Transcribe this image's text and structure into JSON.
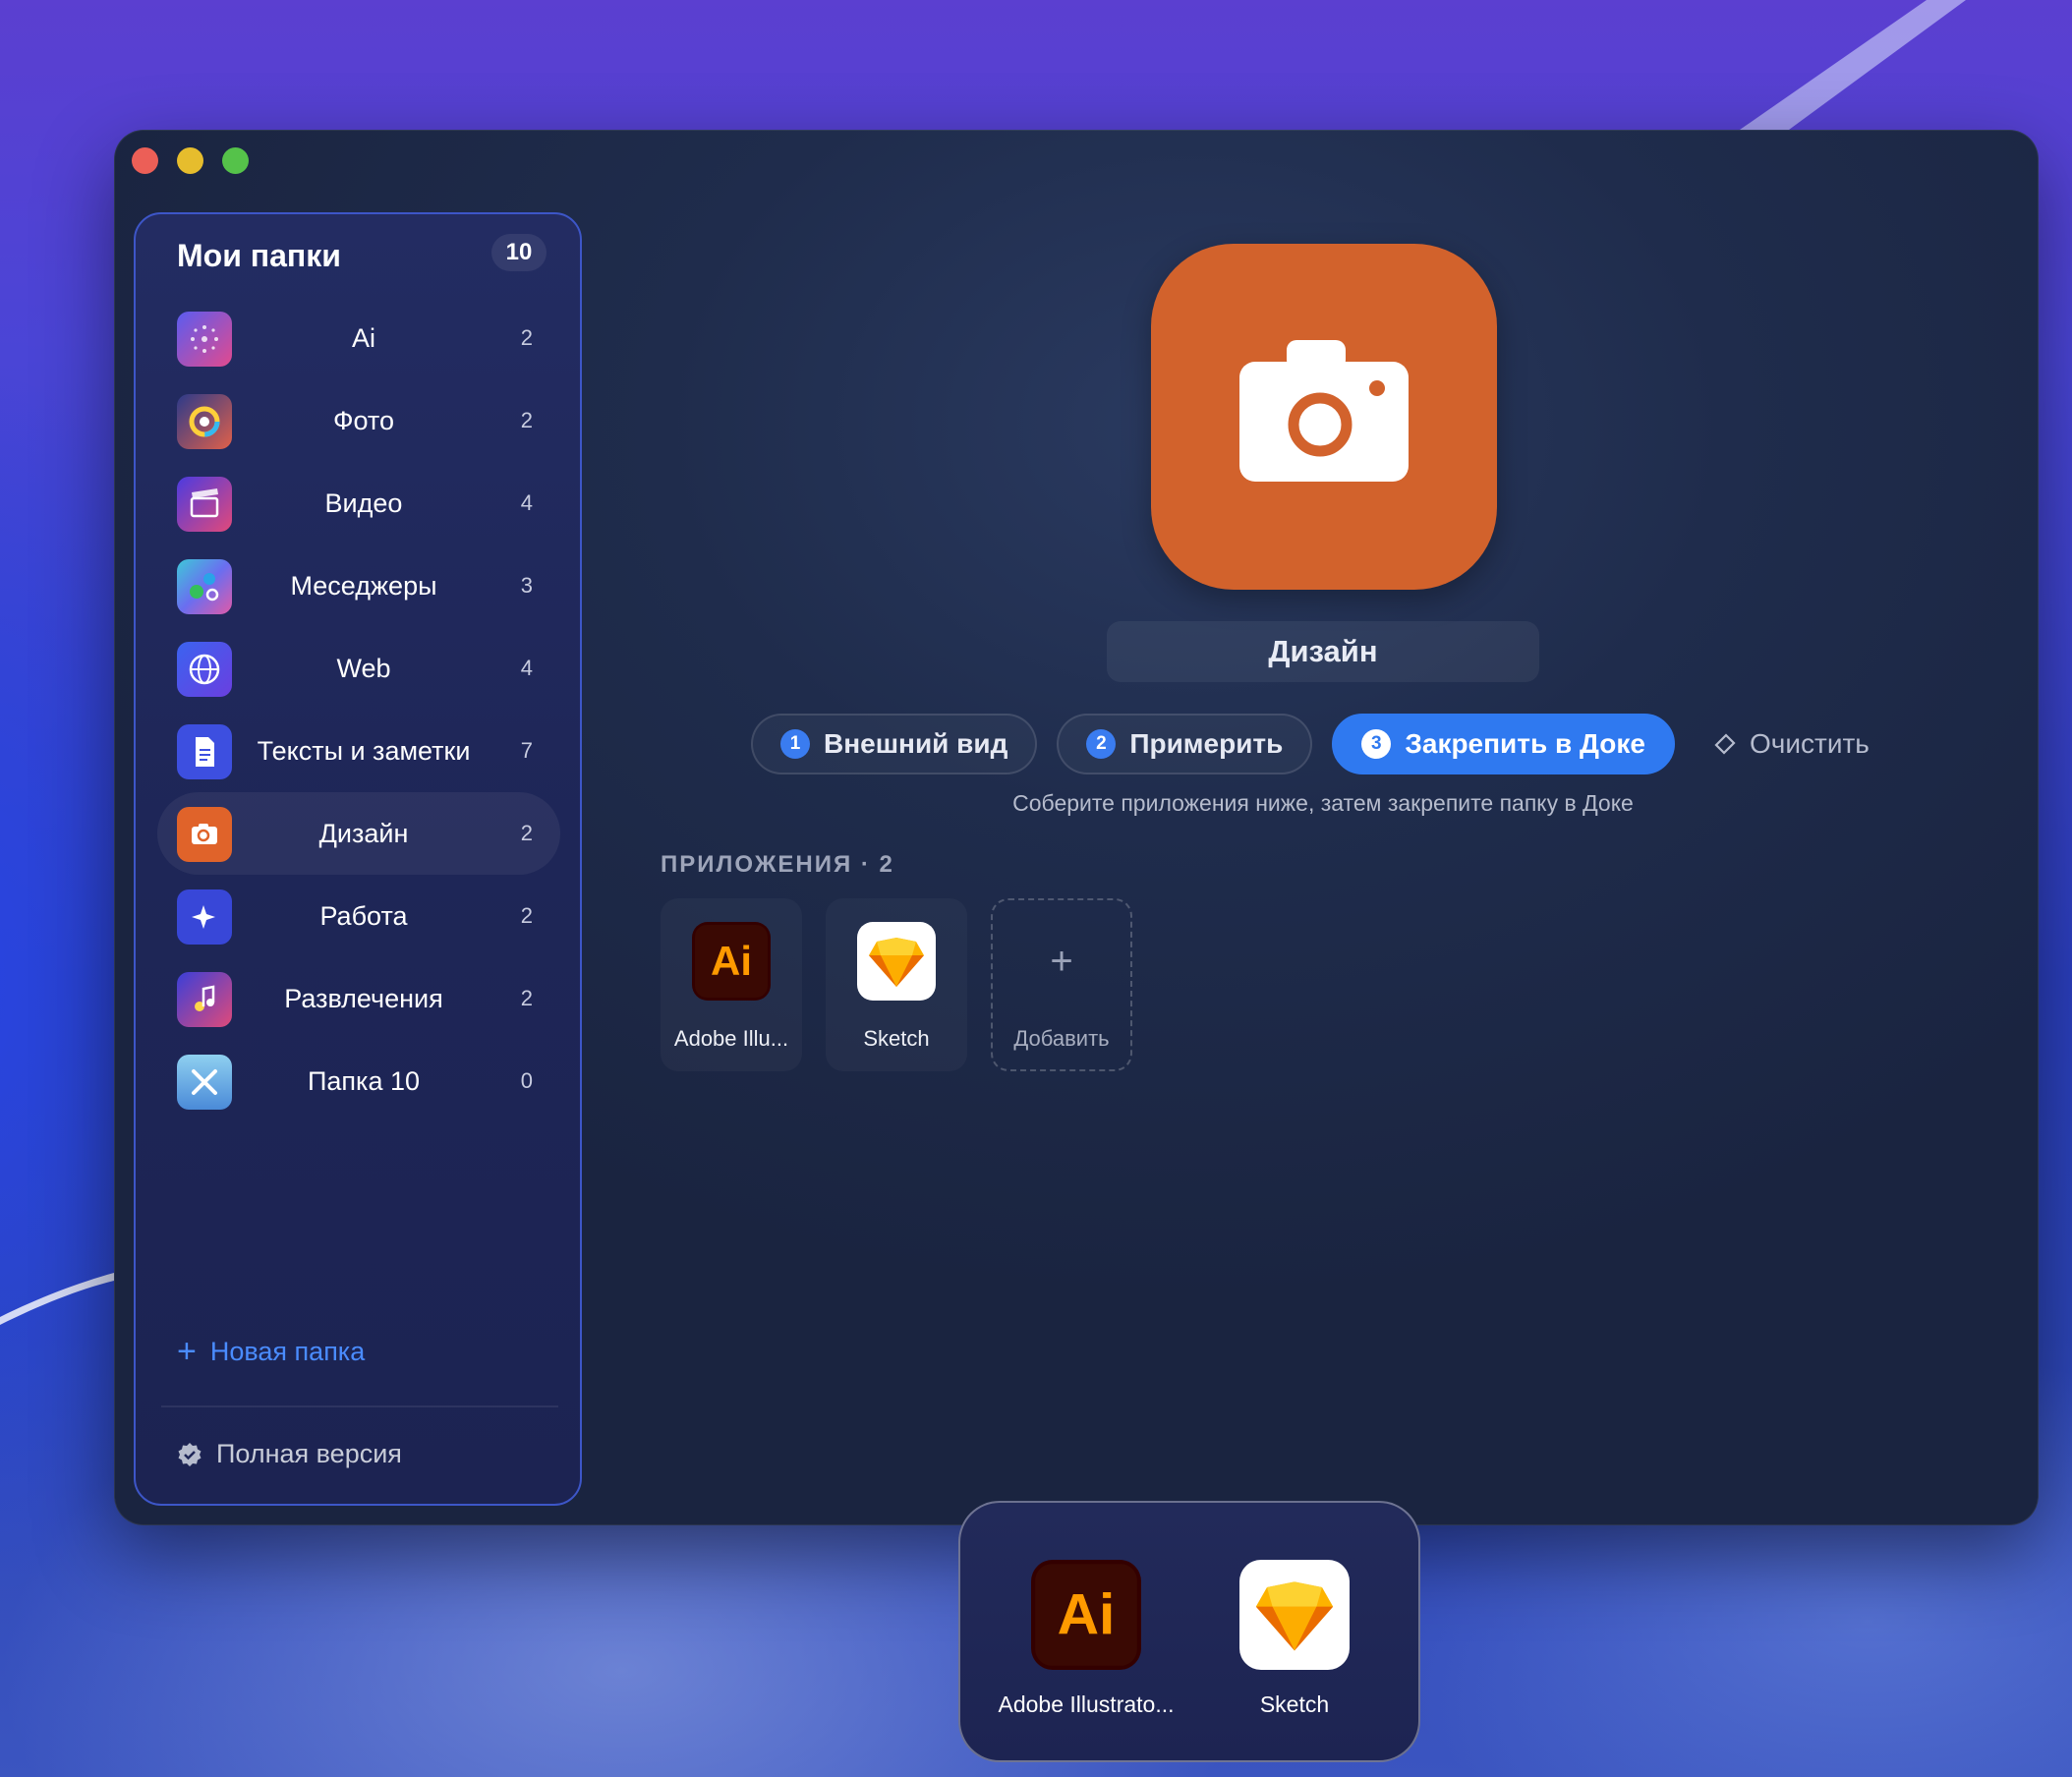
{
  "window": {
    "controls": [
      "close",
      "minimize",
      "zoom"
    ]
  },
  "sidebar": {
    "title": "Мои папки",
    "count": "10",
    "items": [
      {
        "label": "Ai",
        "count": "2",
        "icon": "sparkle-dots-icon"
      },
      {
        "label": "Фото",
        "count": "2",
        "icon": "photos-icon"
      },
      {
        "label": "Видео",
        "count": "4",
        "icon": "video-clapper-icon"
      },
      {
        "label": "Меседжеры",
        "count": "3",
        "icon": "messengers-icon"
      },
      {
        "label": "Web",
        "count": "4",
        "icon": "globe-icon"
      },
      {
        "label": "Тексты и заметки",
        "count": "7",
        "icon": "document-icon"
      },
      {
        "label": "Дизайн",
        "count": "2",
        "icon": "camera-icon",
        "active": true
      },
      {
        "label": "Работа",
        "count": "2",
        "icon": "sparkle-icon"
      },
      {
        "label": "Развлечения",
        "count": "2",
        "icon": "music-icon"
      },
      {
        "label": "Папка 10",
        "count": "0",
        "icon": "tools-icon"
      }
    ],
    "new_folder": "Новая папка",
    "full_version": "Полная версия"
  },
  "folder": {
    "name": "Дизайн",
    "icon": "camera-icon",
    "color": "#d2622c"
  },
  "steps": [
    {
      "num": "1",
      "label": "Внешний вид"
    },
    {
      "num": "2",
      "label": "Примерить"
    },
    {
      "num": "3",
      "label": "Закрепить в Доке"
    }
  ],
  "clear_label": "Очистить",
  "hint": "Соберите приложения ниже, затем закрепите папку в Доке",
  "apps": {
    "header": "ПРИЛОЖЕНИЯ · 2",
    "items": [
      {
        "label": "Adobe Illu...",
        "icon": "adobe-illustrator-icon"
      },
      {
        "label": "Sketch",
        "icon": "sketch-icon"
      }
    ],
    "add_label": "Добавить"
  },
  "dock": {
    "items": [
      {
        "label": "Adobe Illustrato...",
        "icon": "adobe-illustrator-icon"
      },
      {
        "label": "Sketch",
        "icon": "sketch-icon"
      }
    ]
  },
  "colors": {
    "accent": "#2f79f0",
    "sidebar_border": "#3d56c8",
    "link": "#4a8cff"
  }
}
